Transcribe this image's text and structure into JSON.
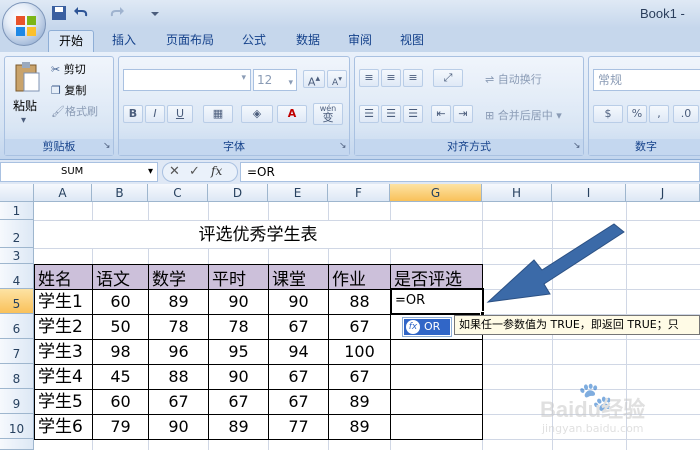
{
  "title_bar": {
    "book_title": "Book1 -"
  },
  "tabs": [
    "开始",
    "插入",
    "页面布局",
    "公式",
    "数据",
    "审阅",
    "视图"
  ],
  "ribbon": {
    "clipboard": {
      "paste": "粘贴",
      "cut": "剪切",
      "copy": "复制",
      "format_painter": "格式刷",
      "label": "剪贴板"
    },
    "font": {
      "font_size": "12",
      "label": "字体",
      "grow": "A",
      "shrink": "A",
      "bold": "B",
      "italic": "I",
      "underline": "U",
      "font_color": "A",
      "wen": "wén",
      "wen_char": "变"
    },
    "alignment": {
      "wrap_text": "自动换行",
      "merge_center": "合并后居中",
      "label": "对齐方式"
    },
    "number": {
      "format": "常规",
      "percent": "%",
      "comma": ",",
      "label": "数字"
    }
  },
  "formula_bar": {
    "name_box": "SUM",
    "formula": "=OR",
    "fx": "fx"
  },
  "columns": [
    "A",
    "B",
    "C",
    "D",
    "E",
    "F",
    "G",
    "H",
    "I",
    "J"
  ],
  "rows": [
    "1",
    "2",
    "3",
    "4",
    "5",
    "6",
    "7",
    "8",
    "9",
    "10"
  ],
  "sheet": {
    "title": "评选优秀学生表",
    "headers": [
      "姓名",
      "语文",
      "数学",
      "平时",
      "课堂",
      "作业",
      "是否评选"
    ],
    "data": [
      [
        "学生1",
        "60",
        "89",
        "90",
        "90",
        "88"
      ],
      [
        "学生2",
        "50",
        "78",
        "78",
        "67",
        "67"
      ],
      [
        "学生3",
        "98",
        "96",
        "95",
        "94",
        "100"
      ],
      [
        "学生4",
        "45",
        "88",
        "90",
        "67",
        "67"
      ],
      [
        "学生5",
        "60",
        "67",
        "67",
        "67",
        "89"
      ],
      [
        "学生6",
        "79",
        "90",
        "89",
        "77",
        "89"
      ]
    ],
    "active_cell_value": "=OR"
  },
  "autocomplete": {
    "item": "OR",
    "tooltip": "如果任一参数值为 TRUE，即返回 TRUE；只"
  },
  "watermark": {
    "brand": "Baidu经验",
    "url": "jingyan.baidu.com"
  },
  "colors": {
    "header_fill": "#ccc0da",
    "arrow": "#3b6aa8",
    "ribbon_text": "#15428b"
  }
}
